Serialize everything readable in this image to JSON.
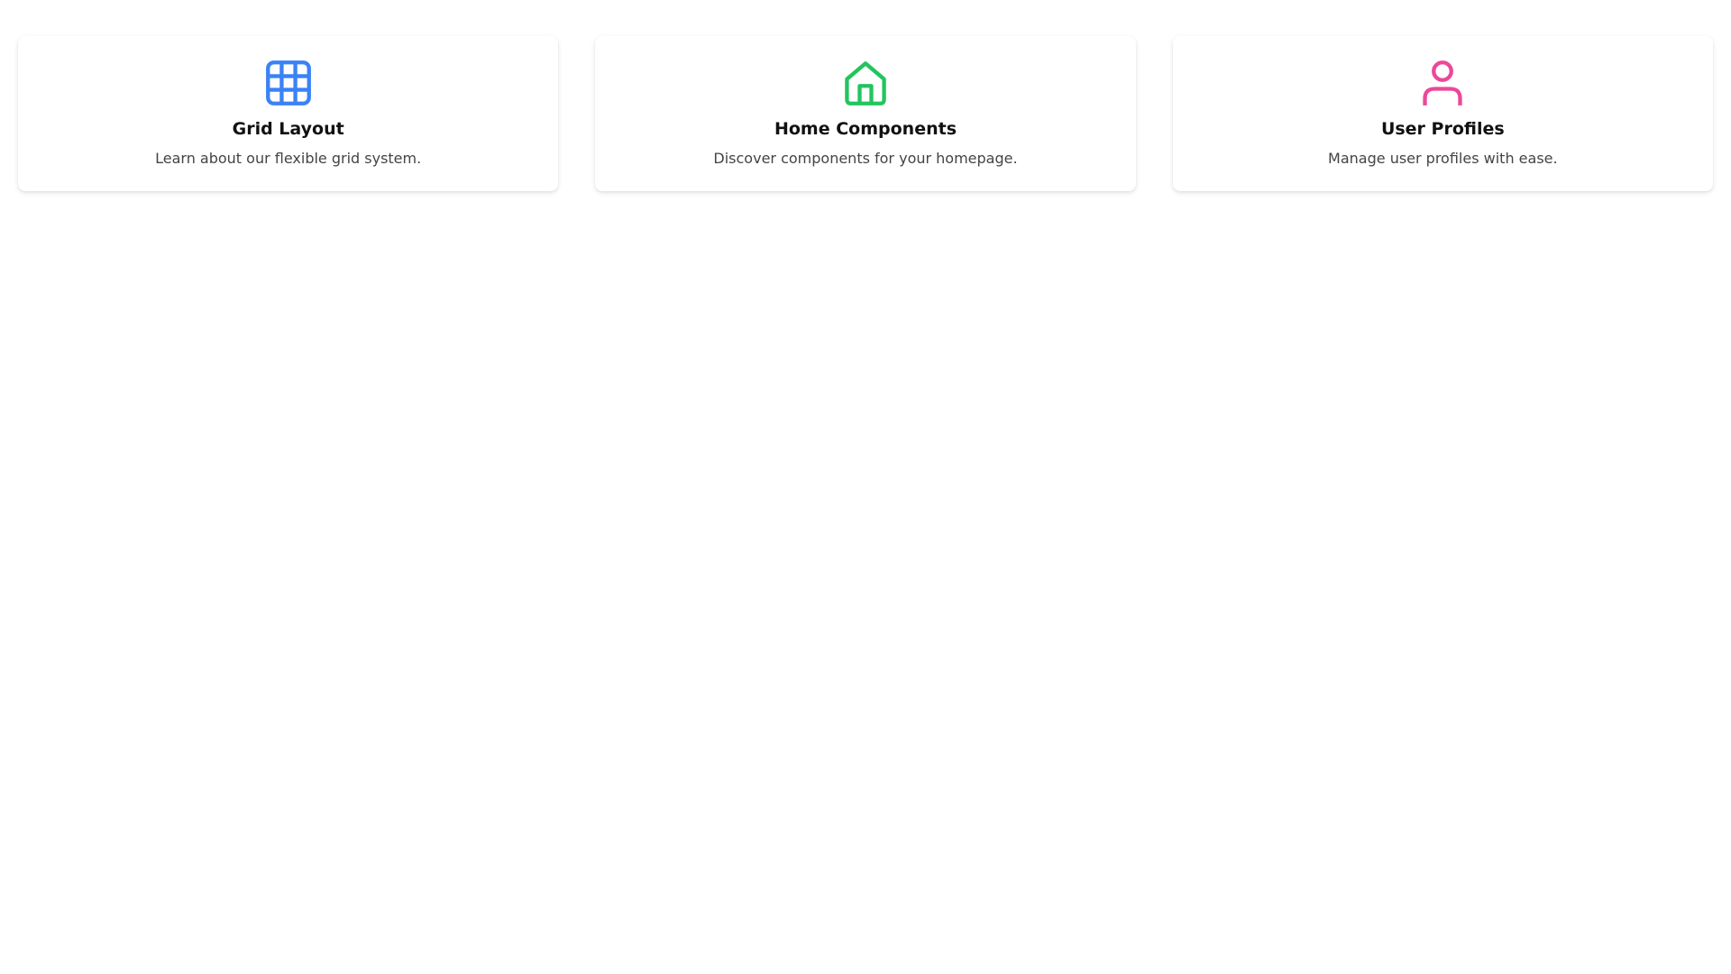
{
  "cards": [
    {
      "title": "Grid Layout",
      "description": "Learn about our flexible grid system.",
      "icon": "grid-icon",
      "icon_color": "#3b82f6"
    },
    {
      "title": "Home Components",
      "description": "Discover components for your homepage.",
      "icon": "home-icon",
      "icon_color": "#22c55e"
    },
    {
      "title": "User Profiles",
      "description": "Manage user profiles with ease.",
      "icon": "user-icon",
      "icon_color": "#ec4899"
    }
  ]
}
